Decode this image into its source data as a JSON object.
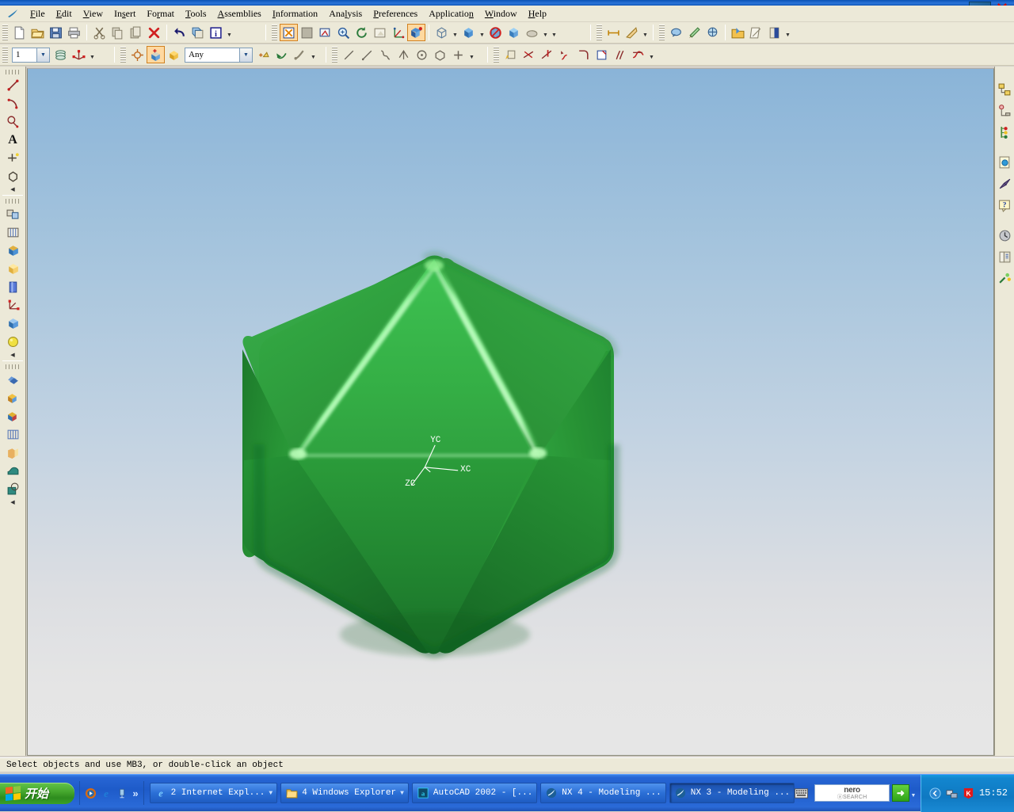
{
  "window": {
    "app_icon": "nx-logo-icon",
    "close_label": "✕"
  },
  "menubar": {
    "app_icon": "nx-app-icon",
    "items": [
      {
        "label": "File",
        "mnemonic": "F"
      },
      {
        "label": "Edit",
        "mnemonic": "E"
      },
      {
        "label": "View",
        "mnemonic": "V"
      },
      {
        "label": "Insert",
        "mnemonic": "s"
      },
      {
        "label": "Format",
        "mnemonic": "r"
      },
      {
        "label": "Tools",
        "mnemonic": "T"
      },
      {
        "label": "Assemblies",
        "mnemonic": "A"
      },
      {
        "label": "Information",
        "mnemonic": "I"
      },
      {
        "label": "Analysis",
        "mnemonic": "l"
      },
      {
        "label": "Preferences",
        "mnemonic": "P"
      },
      {
        "label": "Application",
        "mnemonic": "n"
      },
      {
        "label": "Window",
        "mnemonic": "W"
      },
      {
        "label": "Help",
        "mnemonic": "H"
      }
    ]
  },
  "toolbar_standard": {
    "groups": [
      {
        "buttons": [
          {
            "name": "new-file-icon",
            "tip": "New"
          },
          {
            "name": "open-file-icon",
            "tip": "Open"
          },
          {
            "name": "save-icon",
            "tip": "Save"
          },
          {
            "name": "print-icon",
            "tip": "Plot"
          }
        ]
      },
      {
        "buttons": [
          {
            "name": "cut-icon",
            "tip": "Cut"
          },
          {
            "name": "copy-icon",
            "tip": "Copy"
          },
          {
            "name": "paste-icon",
            "tip": "Paste"
          },
          {
            "name": "delete-icon",
            "tip": "Delete"
          }
        ]
      },
      {
        "buttons": [
          {
            "name": "undo-icon",
            "tip": "Undo"
          },
          {
            "name": "transform-icon",
            "tip": "Transform"
          },
          {
            "name": "information-icon",
            "tip": "Information",
            "has_dropdown": true
          }
        ]
      }
    ],
    "view_group": [
      {
        "name": "fit-view-icon",
        "tip": "Fit"
      },
      {
        "name": "zoom-window-icon",
        "tip": "Zoom"
      },
      {
        "name": "zoom-region-icon",
        "tip": "Zoom Region"
      },
      {
        "name": "magnify-icon",
        "tip": "Magnify"
      },
      {
        "name": "rotate-view-icon",
        "tip": "Rotate"
      },
      {
        "name": "pan-view-icon",
        "tip": "Pan"
      },
      {
        "name": "wcs-orient-icon",
        "tip": "Orient View"
      },
      {
        "name": "shaded-view-icon",
        "tip": "Shaded",
        "active": true
      }
    ],
    "style_group": [
      {
        "name": "wireframe-cube-icon",
        "tip": "Wireframe",
        "has_dropdown": true
      },
      {
        "name": "shaded-cube-icon",
        "tip": "Shaded",
        "has_dropdown": true
      },
      {
        "name": "no-hidden-icon",
        "tip": "Hidden Edges"
      },
      {
        "name": "solid-cube-icon",
        "tip": "Static Wireframe"
      },
      {
        "name": "render-style-icon",
        "tip": "Render Style",
        "has_dropdown": true
      }
    ],
    "measure_group": [
      {
        "name": "measure-distance-icon",
        "tip": "Measure Distance"
      },
      {
        "name": "measure-angle-icon",
        "tip": "Measure Angle",
        "has_dropdown": true
      }
    ],
    "analysis_group": [
      {
        "name": "simple-analysis-icon",
        "tip": "Analysis"
      },
      {
        "name": "section-analysis-icon",
        "tip": "Section"
      },
      {
        "name": "mass-props-icon",
        "tip": "Mass Properties"
      }
    ],
    "doc_group": [
      {
        "name": "open-part-icon",
        "tip": "Open Part"
      },
      {
        "name": "edit-sketch-icon",
        "tip": "Edit Sketch"
      },
      {
        "name": "part-nav-icon",
        "tip": "Part Navigator",
        "has_dropdown": true
      }
    ]
  },
  "toolbar_utility": {
    "layer_combo": {
      "name": "work-layer-combo",
      "value": "1"
    },
    "layer_buttons": [
      {
        "name": "layer-settings-icon",
        "tip": "Layer Settings"
      },
      {
        "name": "wcs-display-icon",
        "tip": "WCS Display",
        "has_dropdown": true
      }
    ],
    "snap_buttons": [
      {
        "name": "point-snap-icon",
        "tip": "Point Constructor"
      },
      {
        "name": "snap-point-icon",
        "tip": "Snap Point",
        "active": true
      },
      {
        "name": "wcs-origin-icon",
        "tip": "WCS Origin"
      }
    ],
    "filter_combo": {
      "name": "selection-filter-combo",
      "value": "Any"
    },
    "filter_buttons": [
      {
        "name": "select-highlight-icon",
        "tip": "Highlight"
      },
      {
        "name": "deselect-icon",
        "tip": "Deselect All"
      },
      {
        "name": "select-chain-icon",
        "tip": "Select Chain",
        "has_dropdown": true
      }
    ],
    "curve_buttons": [
      {
        "name": "line-icon",
        "tip": "Line"
      },
      {
        "name": "basic-curve-icon",
        "tip": "Basic Curves"
      },
      {
        "name": "spline-icon",
        "tip": "Spline"
      },
      {
        "name": "point-icon",
        "tip": "Point"
      },
      {
        "name": "circle-icon",
        "tip": "Circle"
      },
      {
        "name": "polygon-icon",
        "tip": "Polygon"
      },
      {
        "name": "point-set-icon",
        "tip": "Point Set",
        "has_dropdown": true
      }
    ],
    "edit_curve_buttons": [
      {
        "name": "edit-curve-icon",
        "tip": "Edit Curve"
      },
      {
        "name": "trim-curve-icon",
        "tip": "Trim Curve"
      },
      {
        "name": "divide-curve-icon",
        "tip": "Divide Curve"
      },
      {
        "name": "stretch-curve-icon",
        "tip": "Stretch Curve"
      },
      {
        "name": "fillet-icon",
        "tip": "Fillet"
      },
      {
        "name": "chamfer-icon",
        "tip": "Chamfer"
      },
      {
        "name": "offset-curve-icon",
        "tip": "Offset Curve"
      },
      {
        "name": "bridge-curve-icon",
        "tip": "Bridge Curve",
        "has_dropdown": true
      }
    ]
  },
  "left_rail": {
    "group_curve": [
      {
        "name": "line-tool-icon",
        "tip": "Line"
      },
      {
        "name": "arc-tool-icon",
        "tip": "Arc"
      },
      {
        "name": "circle-tool-icon",
        "tip": "Circle"
      },
      {
        "name": "text-tool-icon",
        "tip": "Text",
        "glyph": "A"
      },
      {
        "name": "point-tool-icon",
        "tip": "Point"
      },
      {
        "name": "polygon-tool-icon",
        "tip": "Polygon"
      }
    ],
    "group_feature": [
      {
        "name": "datum-plane-icon",
        "tip": "Datum Plane"
      },
      {
        "name": "extrude-icon",
        "tip": "Extruded Body"
      },
      {
        "name": "revolve-icon",
        "tip": "Revolved Body"
      },
      {
        "name": "sweep-icon",
        "tip": "Swept Body"
      },
      {
        "name": "tube-icon",
        "tip": "Tube"
      },
      {
        "name": "datum-csys-icon",
        "tip": "Datum CSYS"
      },
      {
        "name": "block-icon",
        "tip": "Block"
      },
      {
        "name": "sphere-icon",
        "tip": "Sphere"
      }
    ],
    "group_operation": [
      {
        "name": "unite-icon",
        "tip": "Unite"
      },
      {
        "name": "subtract-icon",
        "tip": "Subtract"
      },
      {
        "name": "intersect-icon",
        "tip": "Intersect"
      },
      {
        "name": "sew-icon",
        "tip": "Sew"
      },
      {
        "name": "trim-body-icon",
        "tip": "Trim Body"
      },
      {
        "name": "blend-icon",
        "tip": "Edge Blend"
      },
      {
        "name": "hollow-icon",
        "tip": "Hollow"
      }
    ]
  },
  "right_rail": {
    "items": [
      {
        "name": "assembly-navigator-icon",
        "tip": "Assembly Navigator"
      },
      {
        "name": "constraint-navigator-icon",
        "tip": "Constraint Navigator"
      },
      {
        "name": "part-navigator-icon",
        "tip": "Part Navigator"
      },
      {
        "name": "web-browser-icon",
        "tip": "Web Browser"
      },
      {
        "name": "history-palette-icon",
        "tip": "History Palette"
      },
      {
        "name": "help-icon",
        "tip": "Context Help"
      },
      {
        "name": "clock-icon",
        "tip": "Recent"
      },
      {
        "name": "library-icon",
        "tip": "Reuse Library"
      },
      {
        "name": "roles-icon",
        "tip": "Roles"
      }
    ]
  },
  "viewport": {
    "background_top": "#8ab4d8",
    "background_bottom": "#e6e6e6",
    "model": {
      "name": "icosahedron-solid",
      "face_color": "#2fa83f",
      "highlight_color": "#6ff070",
      "shadow_color": "#1c6b28"
    },
    "triad": {
      "name": "wcs-triad",
      "color": "#ffffff",
      "axes": [
        {
          "label": "YC"
        },
        {
          "label": "XC"
        },
        {
          "label": "ZC"
        }
      ]
    }
  },
  "statusbar": {
    "message": "Select objects and use MB3, or double-click an object"
  },
  "taskbar": {
    "start_label": "开始",
    "quicklaunch": [
      {
        "name": "media-player-icon",
        "tip": "Windows Media Player"
      },
      {
        "name": "internet-explorer-icon",
        "tip": "Internet Explorer"
      },
      {
        "name": "show-desktop-icon",
        "tip": "Show Desktop"
      }
    ],
    "quicklaunch_more": "»",
    "tasks": [
      {
        "name": "task-internet-explorer",
        "icon": "internet-explorer-icon",
        "label": "2 Internet Expl...",
        "grouped": true,
        "pressed": false
      },
      {
        "name": "task-windows-explorer",
        "icon": "folder-icon",
        "label": "4 Windows Explorer",
        "grouped": true,
        "pressed": false
      },
      {
        "name": "task-autocad",
        "icon": "autocad-icon",
        "label": "AutoCAD 2002 - [...",
        "grouped": false,
        "pressed": false
      },
      {
        "name": "task-nx4",
        "icon": "nx-icon",
        "label": "NX 4 - Modeling ...",
        "grouped": false,
        "pressed": false
      },
      {
        "name": "task-nx3",
        "icon": "nx-icon",
        "label": "NX 3 - Modeling ...",
        "grouped": false,
        "pressed": true
      }
    ],
    "nero": {
      "name": "nero-search-box",
      "top": "nero",
      "bottom": "ⓐSEARCH",
      "go_label": "➜"
    },
    "tray": [
      {
        "name": "tray-expand-icon",
        "glyph": "❮"
      },
      {
        "name": "network-icon",
        "glyph": ""
      },
      {
        "name": "kaspersky-icon",
        "glyph": "K"
      }
    ],
    "clock": "15:52"
  }
}
